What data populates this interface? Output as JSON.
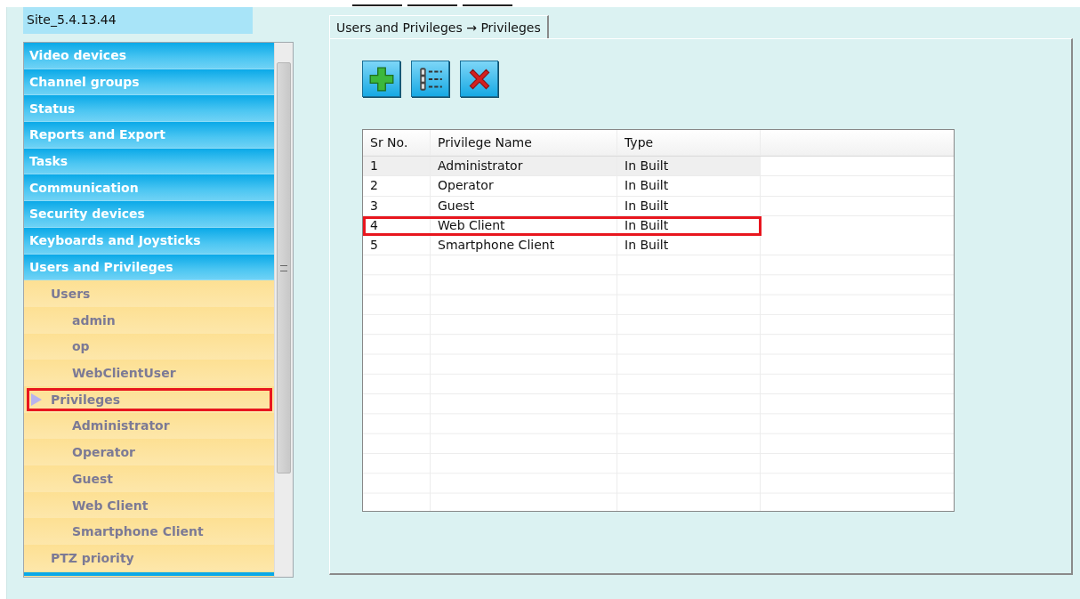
{
  "site": {
    "label": "Site_5.4.13.44"
  },
  "tree": [
    {
      "label": "Video devices",
      "kind": "section"
    },
    {
      "label": "Channel groups",
      "kind": "section"
    },
    {
      "label": "Status",
      "kind": "section"
    },
    {
      "label": "Reports and Export",
      "kind": "section"
    },
    {
      "label": "Tasks",
      "kind": "section"
    },
    {
      "label": "Communication",
      "kind": "section"
    },
    {
      "label": "Security devices",
      "kind": "section"
    },
    {
      "label": "Keyboards and Joysticks",
      "kind": "section"
    },
    {
      "label": "Users and Privileges",
      "kind": "section",
      "children": [
        {
          "label": "Users",
          "selected": false,
          "highlighted": false,
          "children": [
            {
              "label": "admin",
              "selected": false,
              "highlighted": false
            },
            {
              "label": "op",
              "selected": false,
              "highlighted": false
            },
            {
              "label": "WebClientUser",
              "selected": false,
              "highlighted": false
            }
          ]
        },
        {
          "label": "Privileges",
          "selected": true,
          "highlighted": true,
          "children": [
            {
              "label": "Administrator",
              "selected": false,
              "highlighted": false
            },
            {
              "label": "Operator",
              "selected": false,
              "highlighted": false
            },
            {
              "label": "Guest",
              "selected": false,
              "highlighted": false
            },
            {
              "label": "Web Client",
              "selected": false,
              "highlighted": false
            },
            {
              "label": "Smartphone Client",
              "selected": false,
              "highlighted": false
            }
          ]
        },
        {
          "label": "PTZ priority",
          "selected": false,
          "highlighted": false
        }
      ]
    }
  ],
  "tab": {
    "label": "Users and Privileges → Privileges",
    "selected": true
  },
  "toolbar": [
    {
      "kind": "add"
    },
    {
      "kind": "list"
    },
    {
      "kind": "delete"
    }
  ],
  "table": {
    "columns": [
      "Sr No.",
      "Privilege Name",
      "Type"
    ],
    "rows": [
      {
        "cells": [
          "1",
          "Administrator",
          "In Built"
        ],
        "selected": true,
        "highlighted": false
      },
      {
        "cells": [
          "2",
          "Operator",
          "In Built"
        ],
        "selected": false,
        "highlighted": false
      },
      {
        "cells": [
          "3",
          "Guest",
          "In Built"
        ],
        "selected": false,
        "highlighted": false
      },
      {
        "cells": [
          "4",
          "Web Client",
          "In Built"
        ],
        "selected": false,
        "highlighted": true
      },
      {
        "cells": [
          "5",
          "Smartphone Client",
          "In Built"
        ],
        "selected": false,
        "highlighted": false
      }
    ]
  }
}
